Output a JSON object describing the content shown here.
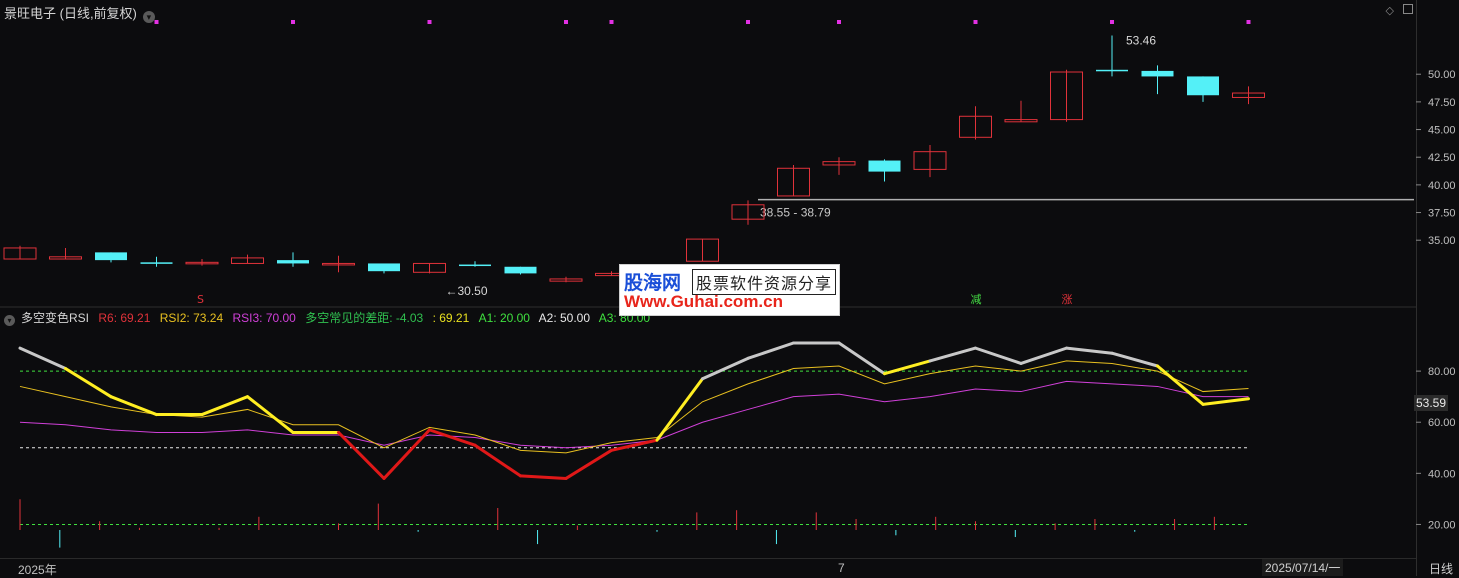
{
  "header": {
    "title": "景旺电子 (日线,前复权)",
    "chevron": "chevron-down-icon",
    "icons": [
      "diamond-icon",
      "restore-window-icon"
    ]
  },
  "colors": {
    "bg": "#0c0c0e",
    "up": "#e0323a",
    "down": "#54f0f7",
    "grid": "#2a2a2a",
    "magenta": "#e331e3",
    "yellow": "#ffee22"
  },
  "chart_data": [
    {
      "type": "candlestick",
      "ylim": [
        30.5,
        54.9
      ],
      "yticks": [
        "50.00",
        "47.50",
        "45.00",
        "42.50",
        "40.00",
        "37.50",
        "35.00"
      ],
      "candles": [
        {
          "o": 33.3,
          "h": 34.5,
          "l": 33.3,
          "c": 34.3
        },
        {
          "o": 33.3,
          "h": 34.3,
          "l": 33.3,
          "c": 33.5
        },
        {
          "o": 33.9,
          "h": 33.9,
          "l": 33.0,
          "c": 33.2
        },
        {
          "o": 33.0,
          "h": 33.5,
          "l": 32.6,
          "c": 32.9
        },
        {
          "o": 33.0,
          "h": 33.3,
          "l": 32.7,
          "c": 33.0
        },
        {
          "o": 32.9,
          "h": 33.7,
          "l": 32.9,
          "c": 33.4
        },
        {
          "o": 33.2,
          "h": 33.9,
          "l": 32.6,
          "c": 32.9
        },
        {
          "o": 32.8,
          "h": 33.6,
          "l": 32.1,
          "c": 32.9
        },
        {
          "o": 32.9,
          "h": 32.9,
          "l": 32.0,
          "c": 32.2
        },
        {
          "o": 32.1,
          "h": 32.9,
          "l": 32.0,
          "c": 32.9
        },
        {
          "o": 32.8,
          "h": 33.1,
          "l": 32.6,
          "c": 32.7
        },
        {
          "o": 32.6,
          "h": 32.6,
          "l": 31.9,
          "c": 32.0
        },
        {
          "o": 31.3,
          "h": 31.7,
          "l": 31.2,
          "c": 31.5
        },
        {
          "o": 31.8,
          "h": 32.2,
          "l": 31.8,
          "c": 32.0
        },
        {
          "o": 32.0,
          "h": 32.5,
          "l": 32.0,
          "c": 32.3
        },
        {
          "o": 33.1,
          "h": 35.1,
          "l": 33.1,
          "c": 35.1
        },
        {
          "o": 36.9,
          "h": 38.6,
          "l": 36.4,
          "c": 38.2
        },
        {
          "o": 39.0,
          "h": 41.8,
          "l": 39.0,
          "c": 41.5
        },
        {
          "o": 41.8,
          "h": 42.5,
          "l": 40.9,
          "c": 42.1
        },
        {
          "o": 42.2,
          "h": 42.3,
          "l": 40.3,
          "c": 41.2
        },
        {
          "o": 41.4,
          "h": 43.6,
          "l": 40.7,
          "c": 43.0
        },
        {
          "o": 44.3,
          "h": 47.1,
          "l": 44.1,
          "c": 46.2
        },
        {
          "o": 45.7,
          "h": 47.6,
          "l": 45.7,
          "c": 45.9
        },
        {
          "o": 45.9,
          "h": 50.4,
          "l": 45.7,
          "c": 50.2
        },
        {
          "o": 50.4,
          "h": 53.5,
          "l": 49.8,
          "c": 50.3
        },
        {
          "o": 50.3,
          "h": 50.8,
          "l": 48.2,
          "c": 49.8
        },
        {
          "o": 49.8,
          "h": 49.8,
          "l": 47.5,
          "c": 48.1
        },
        {
          "o": 47.9,
          "h": 48.9,
          "l": 47.3,
          "c": 48.3
        }
      ],
      "annotations": {
        "high_label": "53.46",
        "low_label": "←30.50",
        "level_label": "38.55 - 38.79",
        "level_value": 38.67,
        "markers": [
          {
            "index": 4,
            "text": "S",
            "color": "#e0323a"
          },
          {
            "index": 21,
            "text": "减",
            "color": "#44dd44"
          },
          {
            "index": 23,
            "text": "涨",
            "color": "#e0323a"
          }
        ],
        "top_dots": [
          3,
          6,
          9,
          12,
          13,
          16,
          18,
          21,
          24,
          27
        ]
      }
    },
    {
      "type": "line",
      "title": "多空变色RSI",
      "ylim": [
        10,
        100
      ],
      "yticks": [
        "80.00",
        "60.00",
        "40.00",
        "20.00"
      ],
      "current_value": "53.59",
      "legend": [
        {
          "text": "R6: 69.21",
          "color": "#e0323a"
        },
        {
          "text": "RSI2: 73.24",
          "color": "#e8c020"
        },
        {
          "text": "RSI3: 70.00",
          "color": "#d040d8"
        },
        {
          "text": "多空常见的差距: -4.03",
          "color": "#30c050"
        },
        {
          "text": ": 69.21",
          "color": "#e8e020"
        },
        {
          "text": "A1: 20.00",
          "color": "#3fe03f"
        },
        {
          "text": "A2: 50.00",
          "color": "#e8e8e8"
        },
        {
          "text": "A3: 80.00",
          "color": "#3fe03f"
        }
      ],
      "series": [
        {
          "name": "R6",
          "values": [
            89.0,
            81.0,
            70.0,
            63.0,
            63.0,
            70.0,
            56.0,
            56.0,
            38.0,
            57.0,
            51.0,
            39.0,
            38.0,
            49.0,
            53.0,
            77.0,
            85.0,
            91.0,
            91.0,
            79.0,
            84.0,
            89.0,
            83.0,
            89.0,
            87.0,
            82.0,
            67.0,
            69.2
          ]
        },
        {
          "name": "RSI2",
          "values": [
            74.0,
            70.0,
            66.0,
            63.0,
            62.0,
            65.0,
            59.0,
            59.0,
            50.0,
            58.0,
            55.0,
            49.0,
            48.0,
            52.0,
            54.0,
            68.0,
            75.0,
            81.0,
            82.0,
            75.0,
            79.0,
            82.0,
            80.0,
            84.0,
            83.0,
            80.0,
            72.0,
            73.2
          ]
        },
        {
          "name": "RSI3",
          "values": [
            60.0,
            59.0,
            57.0,
            56.0,
            56.0,
            57.0,
            55.0,
            55.0,
            51.0,
            55.0,
            54.0,
            51.0,
            50.0,
            51.0,
            53.0,
            60.0,
            65.0,
            70.0,
            71.0,
            68.0,
            70.0,
            73.0,
            72.0,
            76.0,
            75.0,
            74.0,
            70.0,
            70.0
          ]
        }
      ],
      "hlines": [
        20,
        50,
        80
      ],
      "volume_bars": [
        14,
        10,
        4,
        1,
        0,
        1,
        6,
        0,
        3,
        12,
        1,
        0,
        10,
        8,
        2,
        0,
        1,
        8,
        9,
        8,
        8,
        5,
        3,
        6,
        4,
        4,
        3,
        5,
        1,
        5,
        6,
        0
      ]
    }
  ],
  "xaxis": {
    "labels": [
      "2025年",
      "7"
    ],
    "date": "2025/07/14/一",
    "period": "日线"
  }
}
